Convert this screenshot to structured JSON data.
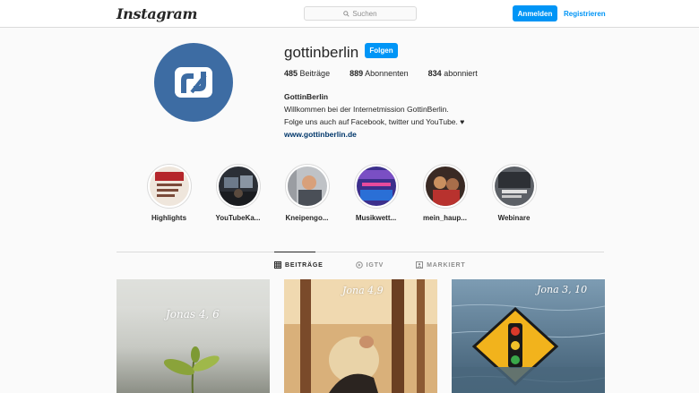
{
  "header": {
    "logo": "Instagram",
    "search_placeholder": "Suchen",
    "login_label": "Anmelden",
    "register_label": "Registrieren"
  },
  "profile": {
    "username": "gottinberlin",
    "follow_label": "Folgen",
    "stats": [
      {
        "count": "485",
        "label": "Beiträge"
      },
      {
        "count": "889",
        "label": "Abonnenten"
      },
      {
        "count": "834",
        "label": "abonniert"
      }
    ],
    "display_name": "GottinBerlin",
    "bio_line1": "Willkommen bei der Internetmission GottinBerlin.",
    "bio_line2": "Folge uns auch auf Facebook, twitter und YouTube. ♥",
    "website": "www.gottinberlin.de"
  },
  "highlights": [
    {
      "label": "Highlights"
    },
    {
      "label": "YouTubeKa..."
    },
    {
      "label": "Kneipengo..."
    },
    {
      "label": "Musikwett..."
    },
    {
      "label": "mein_haup..."
    },
    {
      "label": "Webinare"
    }
  ],
  "tabs": [
    {
      "label": "BEITRÄGE",
      "icon": "grid-icon"
    },
    {
      "label": "IGTV",
      "icon": "igtv-icon"
    },
    {
      "label": "MARKIERT",
      "icon": "tagged-icon"
    }
  ],
  "posts": [
    {
      "caption": "Jonas 4, 6"
    },
    {
      "caption": "Jona 4,9"
    },
    {
      "caption": "Jona 3, 10"
    }
  ],
  "colors": {
    "accent": "#0095f6",
    "avatar_bg": "#3d6ca3",
    "link": "#00376b"
  }
}
